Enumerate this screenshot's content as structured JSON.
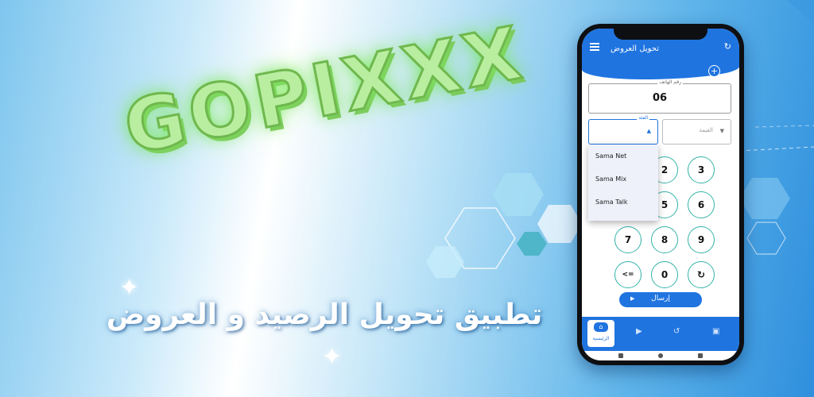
{
  "banner": {
    "logo_text": "GOPIXXX",
    "tagline": "تطبيق  تحويل الرصيد و العروض"
  },
  "phone": {
    "app_title": "تحويل العروض",
    "phone_field": {
      "label": "رقم الهاتف",
      "value": "06"
    },
    "category_field": {
      "label": "الفئة",
      "value": ""
    },
    "value_field": {
      "placeholder": "القيمة"
    },
    "dropdown_options": [
      "Sama Net",
      "Sama Mix",
      "Sama Talk"
    ],
    "keypad": {
      "k1": "2",
      "k2": "3",
      "k3": "5",
      "k4": "6",
      "k5": "7",
      "k6": "8",
      "k7": "9",
      "k8": "<=",
      "k9": "0",
      "k10": "↻"
    },
    "send_label": "إرسال",
    "bottom_nav": {
      "home_label": "الرئيسية"
    }
  },
  "colors": {
    "accent": "#1f74e0",
    "key_border": "#33b3a8",
    "logo_fill": "#b9eea0"
  }
}
